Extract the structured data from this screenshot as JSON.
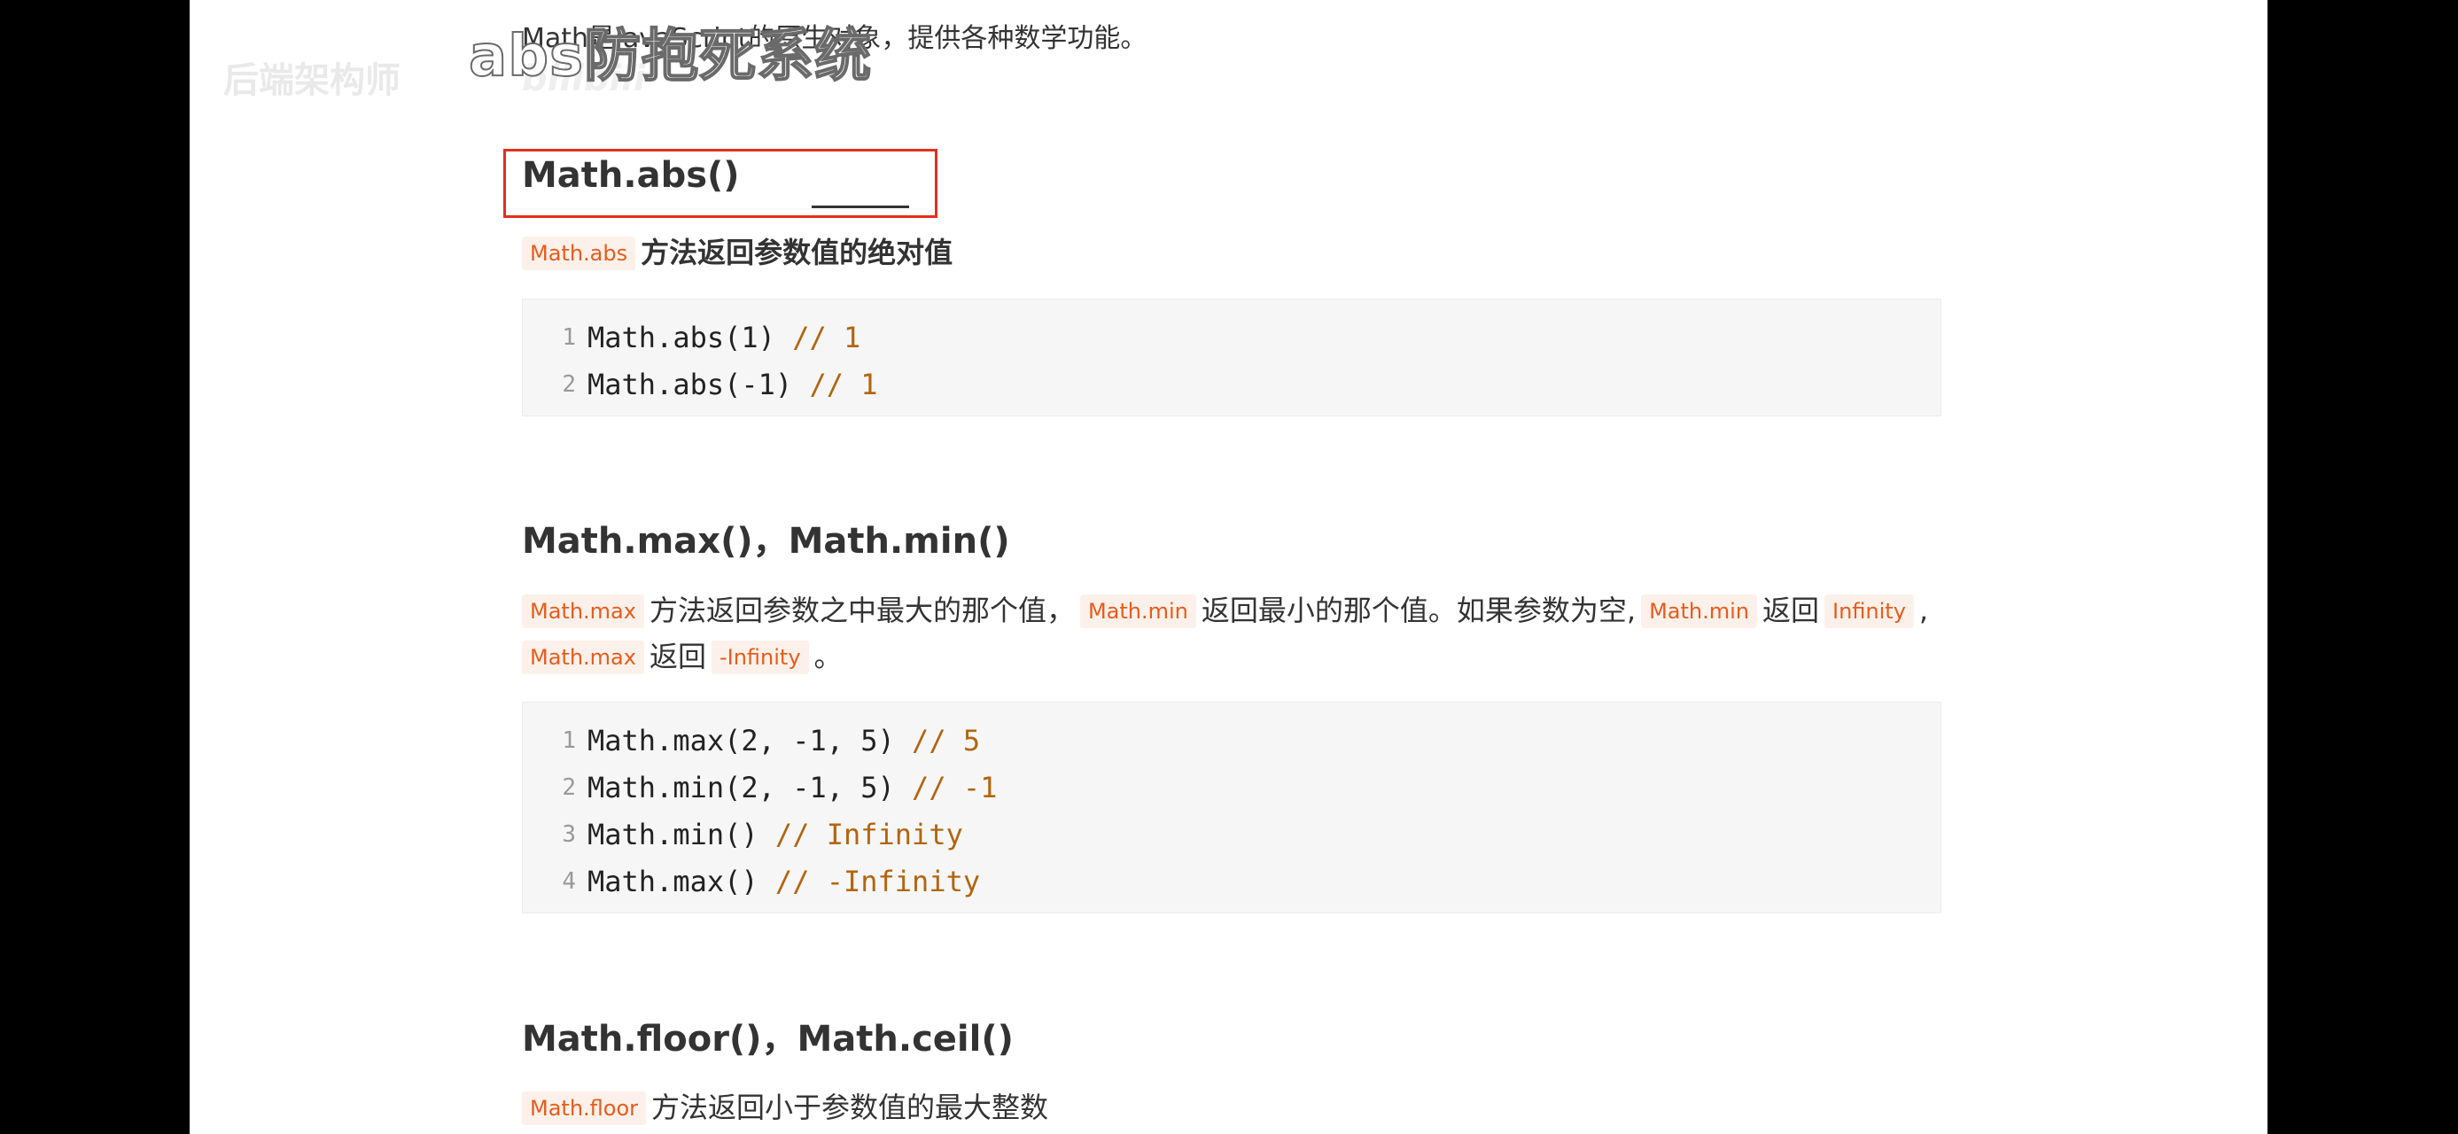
{
  "overlay": {
    "caption": "abs防抱死系统",
    "tag": "后端架构师",
    "logo": "bilibili"
  },
  "intro": {
    "text": "Math是JavaScript的原生对象，提供各种数学功能。"
  },
  "sections": [
    {
      "heading": "Math.abs()",
      "desc": {
        "code": "Math.abs",
        "text": "方法返回参数值的绝对值"
      },
      "lines": [
        {
          "num": "1",
          "code": "Math.abs(1)",
          "comment": "// 1"
        },
        {
          "num": "2",
          "code": "Math.abs(-1)",
          "comment": "// 1"
        }
      ]
    },
    {
      "heading": "Math.max()，Math.min()",
      "desc": {
        "c1": "Math.max",
        "t1": "方法返回参数之中最大的那个值，",
        "c2": "Math.min",
        "t2": "返回最小的那个值。如果参数为空,",
        "c3": "Math.min",
        "t3": "返回",
        "c4": "Infinity",
        "t4": ",",
        "c5": "Math.max",
        "t5": "返回",
        "c6": "-Infinity",
        "t6": "。"
      },
      "lines": [
        {
          "num": "1",
          "code": "Math.max(2, -1, 5)",
          "comment": "// 5"
        },
        {
          "num": "2",
          "code": "Math.min(2, -1, 5)",
          "comment": "// -1"
        },
        {
          "num": "3",
          "code": "Math.min()",
          "comment": "// Infinity"
        },
        {
          "num": "4",
          "code": "Math.max()",
          "comment": "// -Infinity"
        }
      ]
    },
    {
      "heading": "Math.floor()，Math.ceil()",
      "desc": {
        "code": "Math.floor",
        "text": "方法返回小于参数值的最大整数"
      }
    }
  ]
}
